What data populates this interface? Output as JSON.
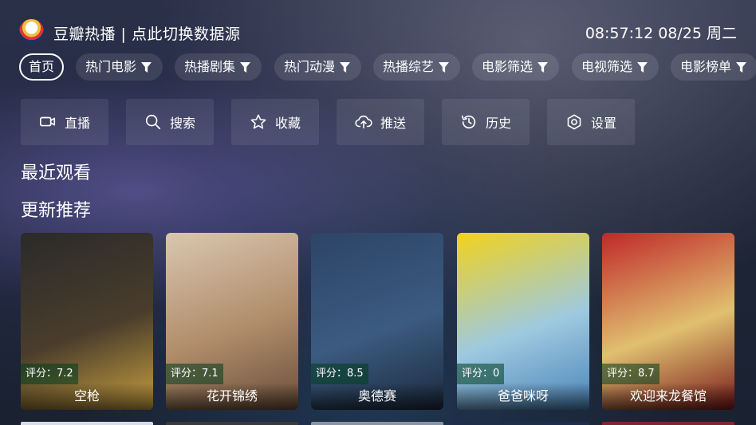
{
  "header": {
    "title": "豆瓣热播 | 点此切换数据源",
    "clock": "08:57:12 08/25 周二"
  },
  "tabs": [
    {
      "label": "首页",
      "active": true,
      "filter": false
    },
    {
      "label": "热门电影",
      "active": false,
      "filter": true
    },
    {
      "label": "热播剧集",
      "active": false,
      "filter": true
    },
    {
      "label": "热门动漫",
      "active": false,
      "filter": true
    },
    {
      "label": "热播综艺",
      "active": false,
      "filter": true
    },
    {
      "label": "电影筛选",
      "active": false,
      "filter": true
    },
    {
      "label": "电视筛选",
      "active": false,
      "filter": true
    },
    {
      "label": "电影榜单",
      "active": false,
      "filter": true
    }
  ],
  "actions": [
    {
      "label": "直播",
      "icon": "tv-icon"
    },
    {
      "label": "搜索",
      "icon": "search-icon"
    },
    {
      "label": "收藏",
      "icon": "star-icon"
    },
    {
      "label": "推送",
      "icon": "cloud-upload-icon"
    },
    {
      "label": "历史",
      "icon": "history-icon"
    },
    {
      "label": "设置",
      "icon": "settings-icon"
    }
  ],
  "sections": {
    "recent": "最近观看",
    "recommend": "更新推荐"
  },
  "cards": [
    {
      "title": "空枪",
      "score": "评分：7.2",
      "colors": [
        "#2a2a2a",
        "#4a3d2c",
        "#c8a040"
      ]
    },
    {
      "title": "花开锦绣",
      "score": "评分：7.1",
      "colors": [
        "#d9c7b0",
        "#b08c6a",
        "#6a4e3a"
      ]
    },
    {
      "title": "奥德赛",
      "score": "评分：8.5",
      "colors": [
        "#2d4466",
        "#3b5b80",
        "#1c2a3e"
      ]
    },
    {
      "title": "爸爸咪呀",
      "score": "评分：0",
      "colors": [
        "#f2d21c",
        "#9ec9e0",
        "#4a84b8"
      ]
    },
    {
      "title": "欢迎来龙餐馆",
      "score": "评分：8.7",
      "colors": [
        "#c0282a",
        "#e0c070",
        "#7a1a1a"
      ]
    }
  ],
  "next_row_colors": [
    "#d9dbe6",
    "#3a3a3a",
    "#8a94a0",
    "#1e2e4a",
    "#7a2a2a"
  ]
}
